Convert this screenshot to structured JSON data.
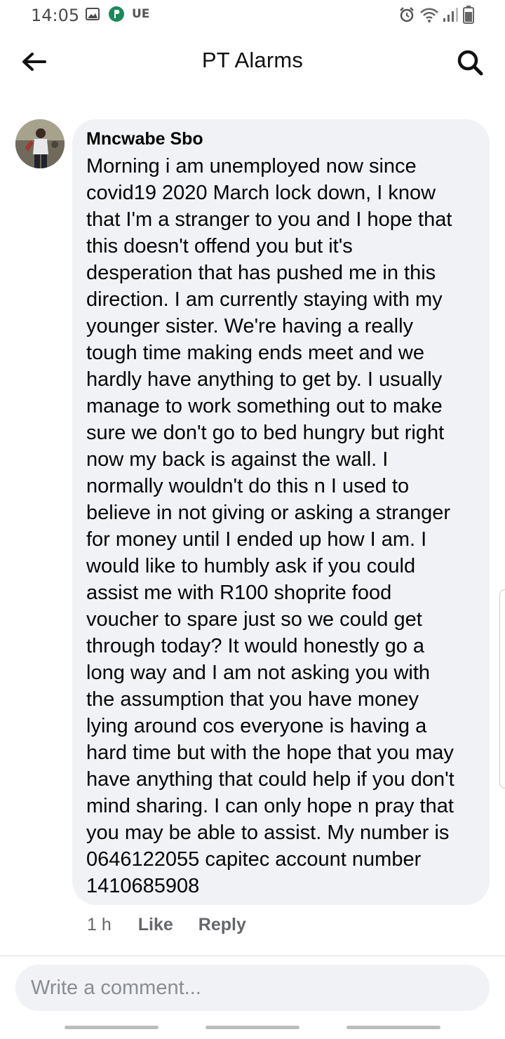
{
  "status_bar": {
    "time": "14:05",
    "carrier": "UE",
    "icons": [
      "gallery-icon",
      "payment-app-icon",
      "alarm-icon",
      "wifi-icon",
      "signal-icon",
      "battery-icon"
    ]
  },
  "header": {
    "title": "PT Alarms",
    "back_icon": "arrow-left-icon",
    "search_icon": "search-icon"
  },
  "comment": {
    "author": "Mncwabe Sbo",
    "body": "Morning i am unemployed now since\ncovid19 2020 March lock down, I know\nthat I'm a stranger to you and I hope that\nthis doesn't offend you but it's\ndesperation that has pushed me in this\ndirection. I am currently staying with my\nyounger sister. We're having a really\ntough time making ends meet and we\nhardly have anything to get by. I usually\nmanage to work something out to make\nsure we don't go to bed hungry but right\nnow my back is against the wall. I\nnormally wouldn't do this n I used to\nbelieve in not giving or asking a stranger\nfor money until I ended up how I am. I\nwould like to humbly ask if you could\nassist me with R100 shoprite food\nvoucher to spare just so we could get\nthrough today? It would honestly go a\nlong way and I am not asking you with\nthe assumption that you have money\nlying around cos everyone is having a\nhard time but with the hope that you may\nhave anything that could help if you don't\nmind sharing. I can only hope n pray that\nyou may be able to assist. My number is\n0646122055 capitec account number\n1410685908",
    "time": "1 h",
    "like_label": "Like",
    "reply_label": "Reply"
  },
  "composer": {
    "placeholder": "Write a comment..."
  },
  "colors": {
    "bubble_bg": "#f0f2f5",
    "meta_text": "#65676b",
    "placeholder": "#8a8d91"
  }
}
